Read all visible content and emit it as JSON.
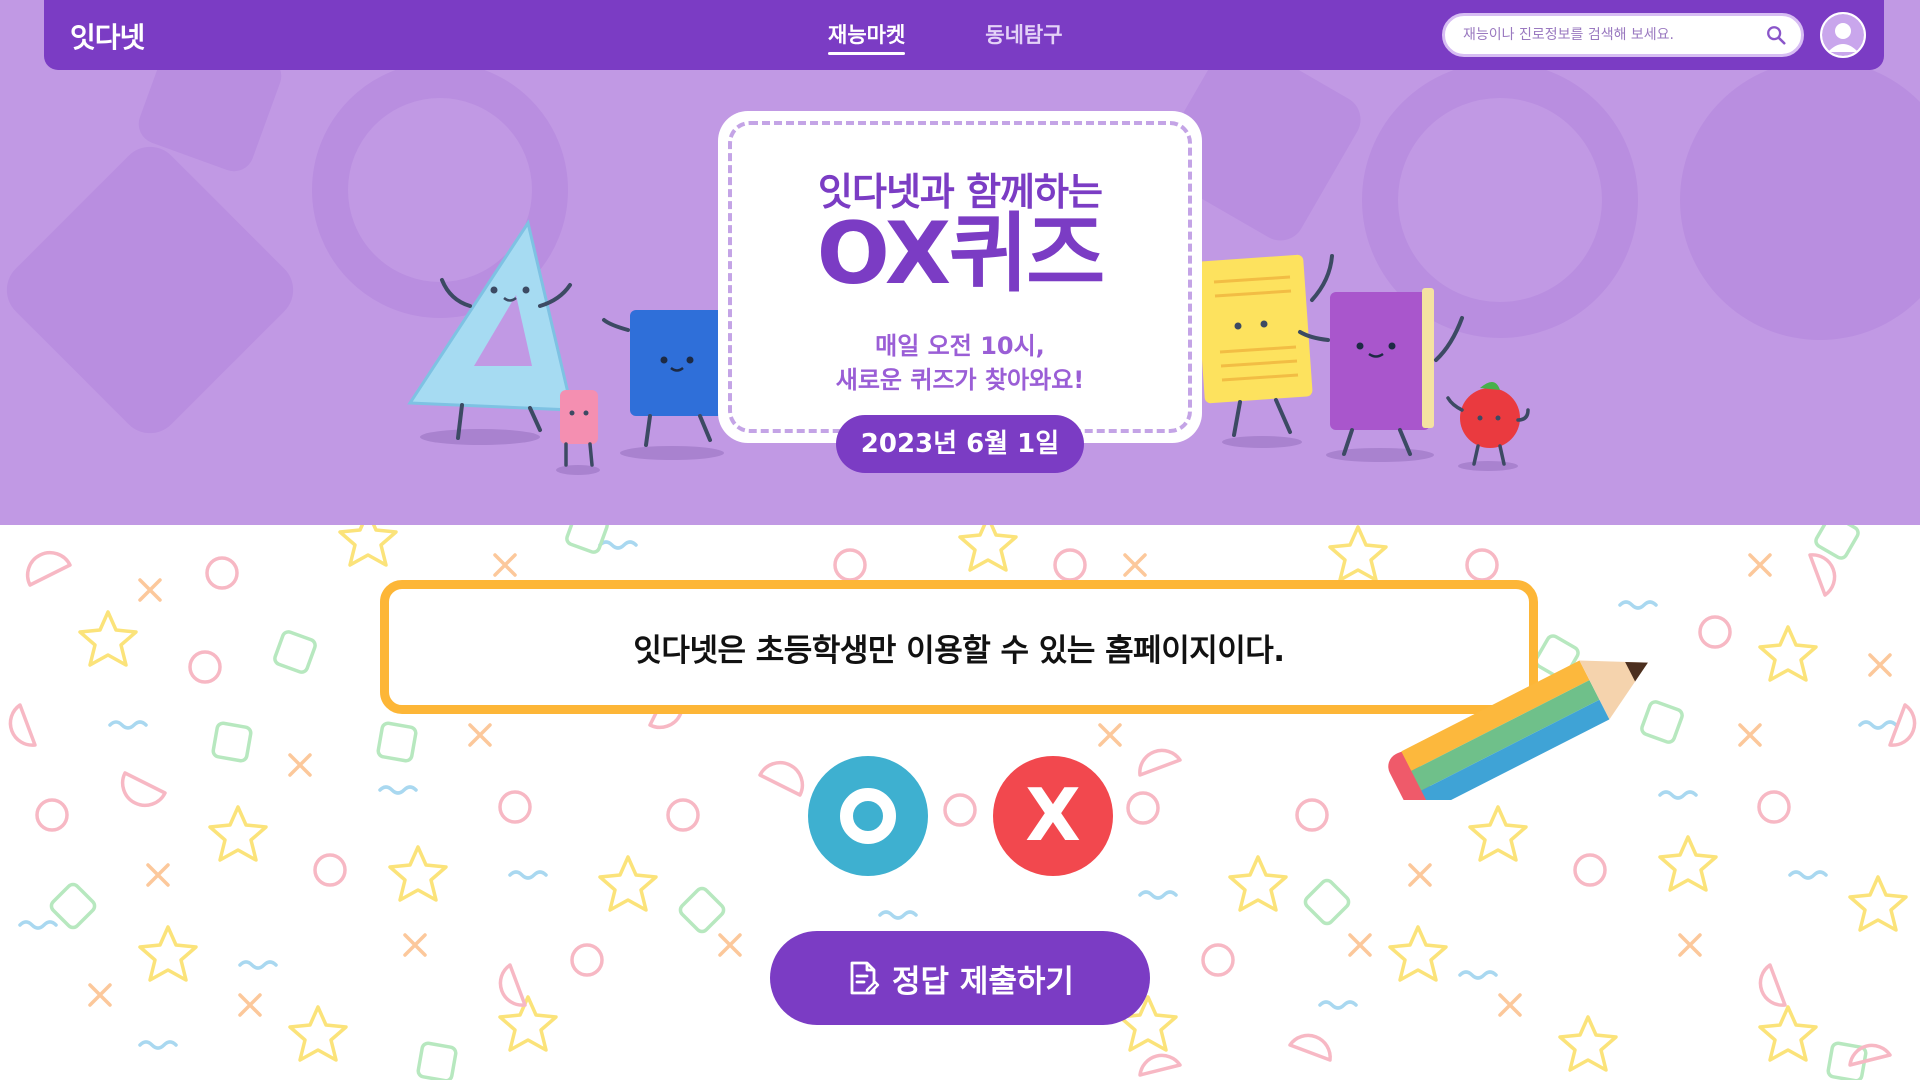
{
  "header": {
    "logo": "잇다넷",
    "nav": [
      {
        "label": "재능마켓",
        "active": true
      },
      {
        "label": "동네탐구",
        "active": false
      }
    ],
    "search_placeholder": "재능이나 진로정보를 검색해 보세요."
  },
  "hero": {
    "title_line1": "잇다넷과 함께하는",
    "title_line2": "OX퀴즈",
    "subtitle_line1": "매일 오전 10시,",
    "subtitle_line2": "새로운 퀴즈가 찾아와요!",
    "date": "2023년 6월 1일"
  },
  "quiz": {
    "question": "잇다넷은 초등학생만 이용할 수 있는 홈페이지이다.",
    "option_o": "O",
    "option_x": "X",
    "submit_label": "정답 제출하기"
  },
  "colors": {
    "brand_purple": "#7b3cc4",
    "hero_bg": "#c199e4",
    "question_border": "#fdb637",
    "o_button": "#3eb0d0",
    "x_button": "#f2484e"
  },
  "icons": [
    "search-icon",
    "user-avatar-icon",
    "document-edit-icon"
  ]
}
